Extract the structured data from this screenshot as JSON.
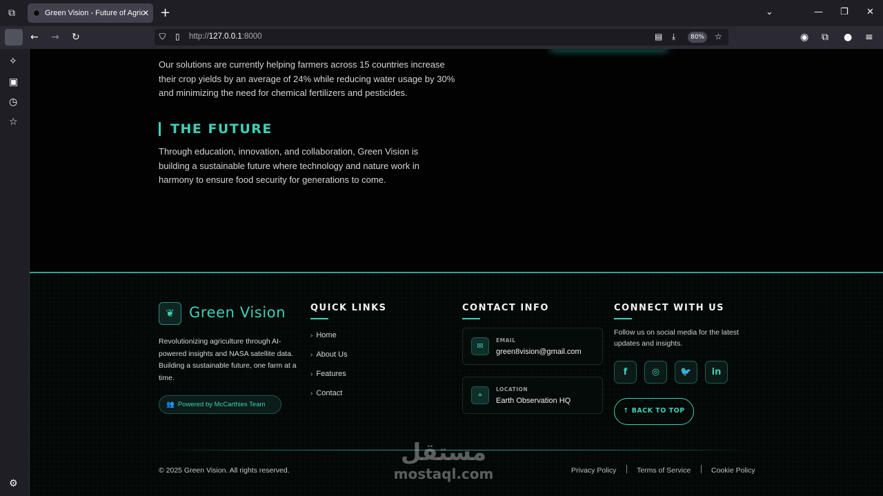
{
  "browser": {
    "tab_title": "Green Vision - Future of Agricul",
    "url_prefix": "http://",
    "url_host": "127.0.0.1",
    "url_port": ":8000",
    "zoom": "80%"
  },
  "about": {
    "paragraph1": "Our solutions are currently helping farmers across 15 countries increase their crop yields by an average of 24% while reducing water usage by 30% and minimizing the need for chemical fertilizers and pesticides.",
    "future_title": "THE FUTURE",
    "future_text": "Through education, innovation, and collaboration, Green Vision is building a sustainable future where technology and nature work in harmony to ensure food security for generations to come."
  },
  "footer": {
    "brand": "Green Vision",
    "brand_desc": "Revolutionizing agriculture through AI-powered insights and NASA satellite data. Building a sustainable future, one farm at a time.",
    "powered": "Powered by McCarthies Team",
    "quick_links_title": "QUICK LINKS",
    "quick_links": [
      "Home",
      "About Us",
      "Features",
      "Contact"
    ],
    "contact_title": "CONTACT INFO",
    "email_label": "EMAIL",
    "email": "green8vision@gmail.com",
    "location_label": "LOCATION",
    "location": "Earth Observation HQ",
    "connect_title": "CONNECT WITH US",
    "connect_desc": "Follow us on social media for the latest updates and insights.",
    "social": [
      {
        "name": "facebook-icon",
        "glyph": "f"
      },
      {
        "name": "instagram-icon",
        "glyph": "◎"
      },
      {
        "name": "twitter-icon",
        "glyph": "🐦"
      },
      {
        "name": "linkedin-icon",
        "glyph": "in"
      }
    ],
    "back_to_top": "BACK TO TOP",
    "copyright": "© 2025 Green Vision. All rights reserved.",
    "legal": [
      "Privacy Policy",
      "Terms of Service",
      "Cookie Policy"
    ]
  },
  "watermark": {
    "arabic": "مستقل",
    "latin": "mostaql.com"
  },
  "colors": {
    "accent": "#3fd0b8",
    "background": "#020202"
  }
}
